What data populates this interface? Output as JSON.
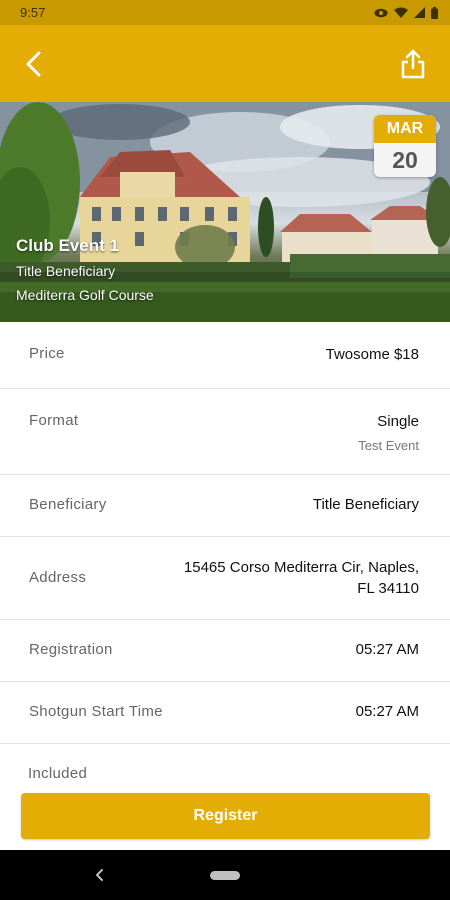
{
  "status_bar": {
    "time": "9:57",
    "icons": [
      "eye-icon",
      "wifi-icon",
      "signal-icon",
      "battery-icon"
    ]
  },
  "app_bar": {
    "back_icon": "chevron-left-icon",
    "share_icon": "share-icon",
    "color": "#e3ad05"
  },
  "event": {
    "title": "Club Event 1",
    "beneficiary": "Title Beneficiary",
    "course": "Mediterra Golf Course",
    "date": {
      "month": "MAR",
      "day": "20"
    }
  },
  "details": [
    {
      "label": "Price",
      "value": "Twosome $18"
    },
    {
      "label": "Format",
      "value": "Single",
      "subvalue": "Test Event"
    },
    {
      "label": "Beneficiary",
      "value": "Title Beneficiary"
    },
    {
      "label": "Address",
      "value_lines": [
        "15465 Corso Mediterra Cir, Naples,",
        "FL 34110"
      ]
    },
    {
      "label": "Registration",
      "value": "05:27 AM"
    },
    {
      "label": "Shotgun Start Time",
      "value": "05:27 AM"
    },
    {
      "label": "Included"
    }
  ],
  "register": {
    "label": "Register"
  },
  "colors": {
    "accent": "#e3ad05",
    "status_bar": "#c99a00"
  }
}
